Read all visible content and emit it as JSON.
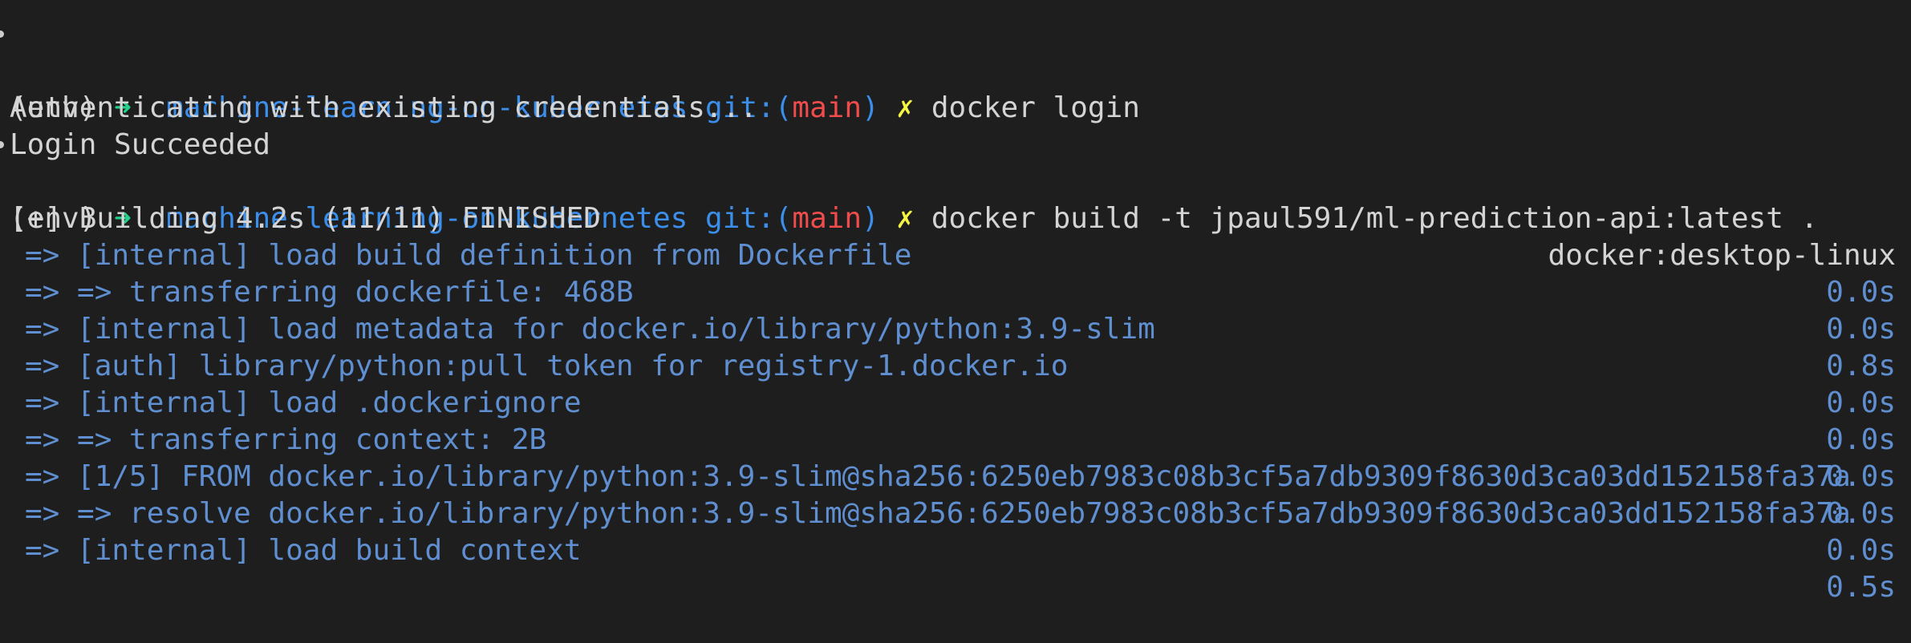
{
  "prompt": {
    "env": "(env)",
    "arrow": "➜",
    "directory": "machine-learning-on-kubernetes",
    "git_prefix": "git:(",
    "branch": "main",
    "git_suffix": ")",
    "dirty": "✗"
  },
  "commands": [
    "docker login",
    "docker build -t jpaul591/ml-prediction-api:latest ."
  ],
  "login_output": [
    "Authenticating with existing credentials...",
    "Login Succeeded"
  ],
  "build_header": {
    "text": "[+] Building 4.2s (11/11) FINISHED",
    "builder": "docker:desktop-linux"
  },
  "build_steps": [
    {
      "text": "=> [internal] load build definition from Dockerfile",
      "time": "0.0s"
    },
    {
      "text": "=> => transferring dockerfile: 468B",
      "time": "0.0s"
    },
    {
      "text": "=> [internal] load metadata for docker.io/library/python:3.9-slim",
      "time": "0.8s"
    },
    {
      "text": "=> [auth] library/python:pull token for registry-1.docker.io",
      "time": "0.0s"
    },
    {
      "text": "=> [internal] load .dockerignore",
      "time": "0.0s"
    },
    {
      "text": "=> => transferring context: 2B",
      "time": "0.0s"
    },
    {
      "text": "=> [1/5] FROM docker.io/library/python:3.9-slim@sha256:6250eb7983c08b3cf5a7db9309f8630d3ca03dd152158fa37a",
      "time": "0.0s"
    },
    {
      "text": "=> => resolve docker.io/library/python:3.9-slim@sha256:6250eb7983c08b3cf5a7db9309f8630d3ca03dd152158fa37a",
      "time": "0.0s"
    },
    {
      "text": "=> [internal] load build context",
      "time": "0.5s"
    }
  ],
  "colors": {
    "background": "#1e1e1e",
    "text": "#d4d4d4",
    "arrow": "#23d18b",
    "directory": "#3b8eea",
    "branch": "#f14c4c",
    "dirty": "#f5f543",
    "build_step": "#5f8fd0"
  }
}
